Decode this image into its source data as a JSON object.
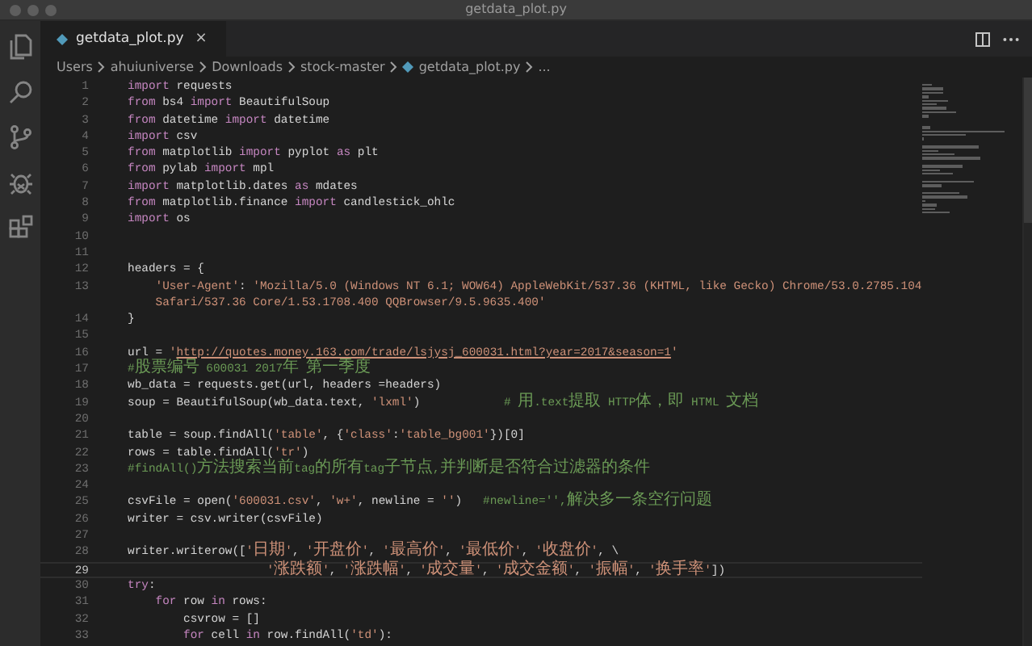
{
  "window": {
    "title": "getdata_plot.py"
  },
  "tabs": [
    {
      "label": "getdata_plot.py",
      "close": "×",
      "selected": true
    }
  ],
  "breadcrumb": [
    {
      "label": "Users",
      "kind": "folder"
    },
    {
      "label": "ahuiuniverse",
      "kind": "folder"
    },
    {
      "label": "Downloads",
      "kind": "folder"
    },
    {
      "label": "stock-master",
      "kind": "folder"
    },
    {
      "label": "getdata_plot.py",
      "kind": "file"
    },
    {
      "label": "...",
      "kind": "more"
    }
  ],
  "editor": {
    "lines": [
      {
        "number": "1",
        "current": false,
        "tokens": [
          {
            "kind": "kw",
            "text": "import"
          },
          {
            "kind": "text",
            "text": " requests"
          }
        ]
      },
      {
        "number": "2",
        "current": false,
        "tokens": [
          {
            "kind": "kw",
            "text": "from"
          },
          {
            "kind": "text",
            "text": " bs4 "
          },
          {
            "kind": "kw",
            "text": "import"
          },
          {
            "kind": "text",
            "text": " BeautifulSoup"
          }
        ]
      },
      {
        "number": "3",
        "current": false,
        "tokens": [
          {
            "kind": "kw",
            "text": "from"
          },
          {
            "kind": "text",
            "text": " datetime "
          },
          {
            "kind": "kw",
            "text": "import"
          },
          {
            "kind": "text",
            "text": " datetime"
          }
        ]
      },
      {
        "number": "4",
        "current": false,
        "tokens": [
          {
            "kind": "kw",
            "text": "import"
          },
          {
            "kind": "text",
            "text": " csv"
          }
        ]
      },
      {
        "number": "5",
        "current": false,
        "tokens": [
          {
            "kind": "kw",
            "text": "from"
          },
          {
            "kind": "text",
            "text": " matplotlib "
          },
          {
            "kind": "kw",
            "text": "import"
          },
          {
            "kind": "text",
            "text": " pyplot "
          },
          {
            "kind": "kw",
            "text": "as"
          },
          {
            "kind": "text",
            "text": " plt"
          }
        ]
      },
      {
        "number": "6",
        "current": false,
        "tokens": [
          {
            "kind": "kw",
            "text": "from"
          },
          {
            "kind": "text",
            "text": " pylab "
          },
          {
            "kind": "kw",
            "text": "import"
          },
          {
            "kind": "text",
            "text": " mpl"
          }
        ]
      },
      {
        "number": "7",
        "current": false,
        "tokens": [
          {
            "kind": "kw",
            "text": "import"
          },
          {
            "kind": "text",
            "text": " matplotlib.dates "
          },
          {
            "kind": "kw",
            "text": "as"
          },
          {
            "kind": "text",
            "text": " mdates"
          }
        ]
      },
      {
        "number": "8",
        "current": false,
        "tokens": [
          {
            "kind": "kw",
            "text": "from"
          },
          {
            "kind": "text",
            "text": " matplotlib.finance "
          },
          {
            "kind": "kw",
            "text": "import"
          },
          {
            "kind": "text",
            "text": " candlestick_ohlc"
          }
        ]
      },
      {
        "number": "9",
        "current": false,
        "tokens": [
          {
            "kind": "kw",
            "text": "import"
          },
          {
            "kind": "text",
            "text": " os"
          }
        ]
      },
      {
        "number": "10",
        "current": false
      },
      {
        "number": "11",
        "current": false
      },
      {
        "number": "12",
        "current": false,
        "tokens": [
          {
            "kind": "text",
            "text": "headers = {"
          }
        ]
      },
      {
        "number": "13",
        "current": false,
        "tokens": [
          {
            "kind": "str",
            "text": "    'User-Agent'"
          },
          {
            "kind": "text",
            "text": ": "
          },
          {
            "kind": "str",
            "text": "'Mozilla/5.0 (Windows NT 6.1; WOW64) AppleWebKit/537.36 (KHTML, like Gecko) Chrome/53.0.2785.104"
          }
        ]
      },
      {
        "current": false,
        "tokens": [
          {
            "kind": "str",
            "text": "    Safari/537.36 Core/1.53.1708.400 QQBrowser/9.5.9635.400'"
          }
        ]
      },
      {
        "number": "14",
        "current": false,
        "tokens": [
          {
            "kind": "text",
            "text": "}"
          }
        ]
      },
      {
        "number": "15",
        "current": false
      },
      {
        "number": "16",
        "current": false,
        "tokens": [
          {
            "kind": "text",
            "text": "url = "
          },
          {
            "kind": "str",
            "text": "'"
          },
          {
            "kind": "link",
            "text": "http://quotes.money.163.com/trade/lsjysj_600031.html?year=2017&season=1"
          },
          {
            "kind": "str",
            "text": "'"
          }
        ]
      },
      {
        "number": "17",
        "current": false,
        "tokens": [
          {
            "kind": "comment",
            "text": "#股票编号 600031 2017年 第一季度"
          }
        ]
      },
      {
        "number": "18",
        "current": false,
        "tokens": [
          {
            "kind": "text",
            "text": "wb_data = requests.get(url, headers =headers)"
          }
        ]
      },
      {
        "number": "19",
        "current": false,
        "tokens": [
          {
            "kind": "text",
            "text": "soup = BeautifulSoup(wb_data.text, "
          },
          {
            "kind": "str",
            "text": "'lxml'"
          },
          {
            "kind": "text",
            "text": ")            "
          },
          {
            "kind": "comment",
            "text": "# 用.text提取 HTTP体，即 HTML 文档"
          }
        ]
      },
      {
        "number": "20",
        "current": false
      },
      {
        "number": "21",
        "current": false,
        "tokens": [
          {
            "kind": "text",
            "text": "table = soup.findAll("
          },
          {
            "kind": "str",
            "text": "'table'"
          },
          {
            "kind": "text",
            "text": ", {"
          },
          {
            "kind": "str",
            "text": "'class'"
          },
          {
            "kind": "text",
            "text": ":"
          },
          {
            "kind": "str",
            "text": "'table_bg001'"
          },
          {
            "kind": "text",
            "text": "})[0]"
          }
        ]
      },
      {
        "number": "22",
        "current": false,
        "tokens": [
          {
            "kind": "text",
            "text": "rows = table.findAll("
          },
          {
            "kind": "str",
            "text": "'tr'"
          },
          {
            "kind": "text",
            "text": ")"
          }
        ]
      },
      {
        "number": "23",
        "current": false,
        "tokens": [
          {
            "kind": "comment",
            "text": "#findAll()方法搜索当前tag的所有tag子节点,并判断是否符合过滤器的条件"
          }
        ]
      },
      {
        "number": "24",
        "current": false
      },
      {
        "number": "25",
        "current": false,
        "tokens": [
          {
            "kind": "text",
            "text": "csvFile = open("
          },
          {
            "kind": "str",
            "text": "'600031.csv'"
          },
          {
            "kind": "text",
            "text": ", "
          },
          {
            "kind": "str",
            "text": "'w+'"
          },
          {
            "kind": "text",
            "text": ", newline = "
          },
          {
            "kind": "str",
            "text": "''"
          },
          {
            "kind": "text",
            "text": ")   "
          },
          {
            "kind": "comment",
            "text": "#newline='',解决多一条空行问题"
          }
        ]
      },
      {
        "number": "26",
        "current": false,
        "tokens": [
          {
            "kind": "text",
            "text": "writer = csv.writer(csvFile)"
          }
        ]
      },
      {
        "number": "27",
        "current": false
      },
      {
        "number": "28",
        "current": false,
        "tokens": [
          {
            "kind": "text",
            "text": "writer.writerow(["
          },
          {
            "kind": "str",
            "text": "'日期'"
          },
          {
            "kind": "text",
            "text": ", "
          },
          {
            "kind": "str",
            "text": "'开盘价'"
          },
          {
            "kind": "text",
            "text": ", "
          },
          {
            "kind": "str",
            "text": "'最高价'"
          },
          {
            "kind": "text",
            "text": ", "
          },
          {
            "kind": "str",
            "text": "'最低价'"
          },
          {
            "kind": "text",
            "text": ", "
          },
          {
            "kind": "str",
            "text": "'收盘价'"
          },
          {
            "kind": "text",
            "text": ", \\"
          }
        ]
      },
      {
        "number": "29",
        "current": true,
        "tokens": [
          {
            "kind": "str",
            "text": "                    '涨跌额'"
          },
          {
            "kind": "text",
            "text": ", "
          },
          {
            "kind": "str",
            "text": "'涨跌幅'"
          },
          {
            "kind": "text",
            "text": ", "
          },
          {
            "kind": "str",
            "text": "'成交量'"
          },
          {
            "kind": "text",
            "text": ", "
          },
          {
            "kind": "str",
            "text": "'成交金额'"
          },
          {
            "kind": "text",
            "text": ", "
          },
          {
            "kind": "str",
            "text": "'振幅'"
          },
          {
            "kind": "text",
            "text": ", "
          },
          {
            "kind": "str",
            "text": "'换手率'"
          },
          {
            "kind": "text",
            "text": "])"
          }
        ]
      },
      {
        "number": "30",
        "current": false,
        "tokens": [
          {
            "kind": "kw",
            "text": "try"
          },
          {
            "kind": "text",
            "text": ":"
          }
        ]
      },
      {
        "number": "31",
        "current": false,
        "tokens": [
          {
            "kind": "kw",
            "text": "    for"
          },
          {
            "kind": "text",
            "text": " row "
          },
          {
            "kind": "kw",
            "text": "in"
          },
          {
            "kind": "text",
            "text": " rows:"
          }
        ]
      },
      {
        "number": "32",
        "current": false,
        "tokens": [
          {
            "kind": "text",
            "text": "        csvrow = []"
          }
        ]
      },
      {
        "number": "33",
        "current": false,
        "tokens": [
          {
            "kind": "kw",
            "text": "        for"
          },
          {
            "kind": "text",
            "text": " cell "
          },
          {
            "kind": "kw",
            "text": "in"
          },
          {
            "kind": "text",
            "text": " row.findAll("
          },
          {
            "kind": "str",
            "text": "'td'"
          },
          {
            "kind": "text",
            "text": "):"
          }
        ]
      }
    ]
  }
}
